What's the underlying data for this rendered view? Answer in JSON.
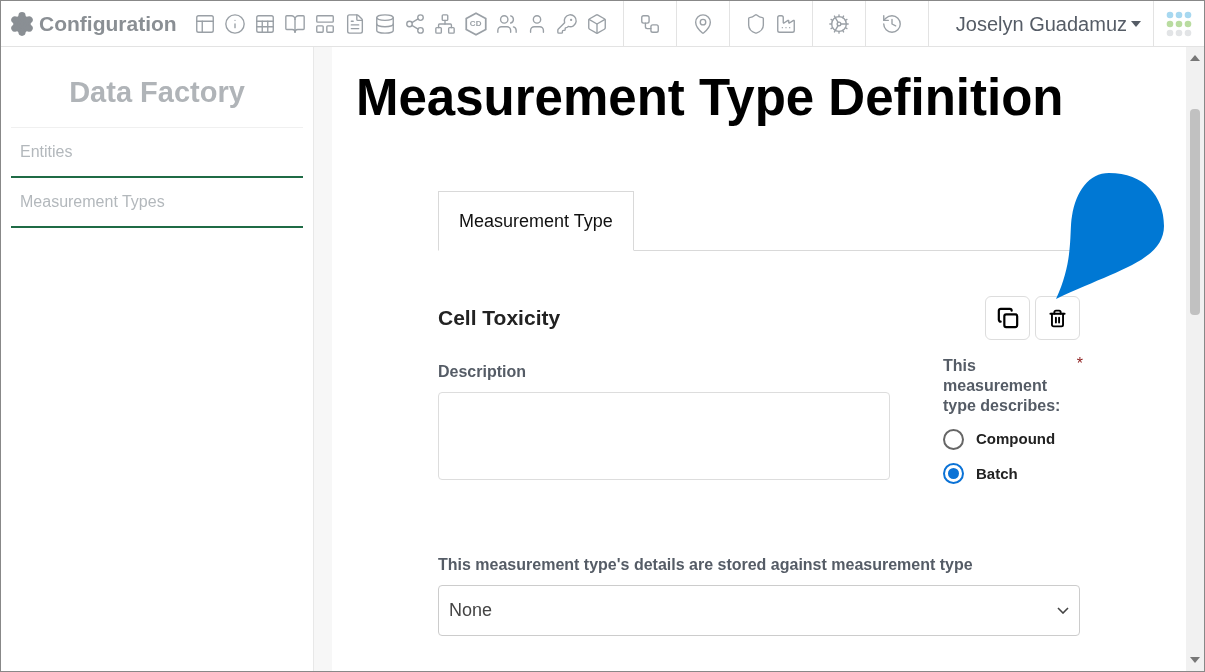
{
  "app": {
    "title": "Configuration"
  },
  "toolbar": [
    {
      "kind": "layout"
    },
    {
      "kind": "info"
    },
    {
      "kind": "table"
    },
    {
      "kind": "book"
    },
    {
      "kind": "grid"
    },
    {
      "kind": "file"
    },
    {
      "kind": "database"
    },
    {
      "kind": "share"
    },
    {
      "kind": "network"
    },
    {
      "kind": "hexbadge",
      "text": "CD"
    },
    {
      "kind": "users"
    },
    {
      "kind": "user"
    },
    {
      "kind": "key"
    },
    {
      "kind": "box"
    },
    {
      "kind": "workflow"
    },
    {
      "kind": "pin"
    },
    {
      "kind": "shield"
    },
    {
      "kind": "factory"
    },
    {
      "kind": "cogs"
    },
    {
      "kind": "history"
    }
  ],
  "user": {
    "name": "Joselyn Guadamuz"
  },
  "sidebar": {
    "title": "Data Factory",
    "items": [
      {
        "label": "Entities"
      },
      {
        "label": "Measurement Types"
      }
    ]
  },
  "page": {
    "title": "Measurement Type Definition",
    "tabs": [
      {
        "label": "Measurement Type",
        "selected": true
      }
    ],
    "record": {
      "name": "Cell Toxicity"
    },
    "description": {
      "label": "Description"
    },
    "describes": {
      "label": "This measurement type describes:",
      "required_mark": "*",
      "options": [
        {
          "label": "Compound",
          "selected": false
        },
        {
          "label": "Batch",
          "selected": true
        }
      ]
    },
    "stored_against": {
      "label": "This measurement type's details are stored against measurement type",
      "value": "None"
    }
  }
}
